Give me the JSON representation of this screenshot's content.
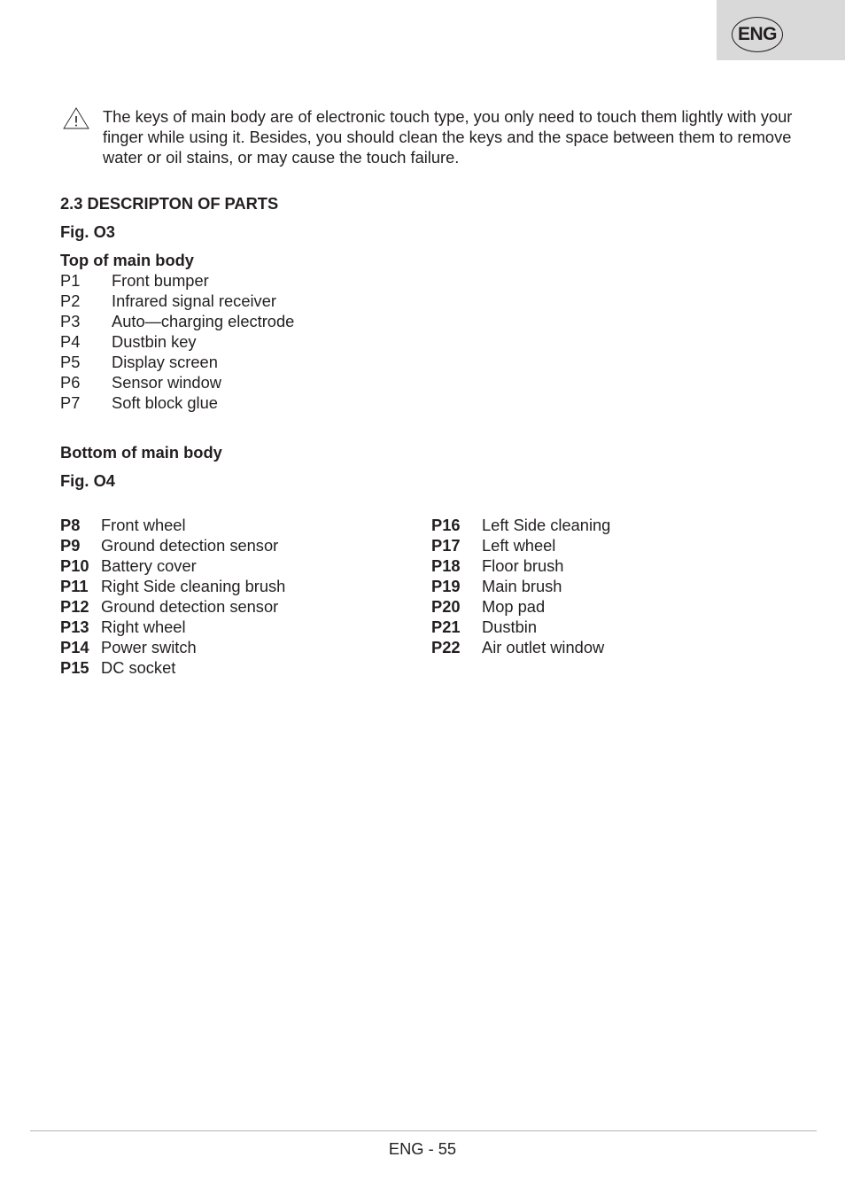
{
  "header": {
    "language_badge": "ENG"
  },
  "warning": {
    "icon": "warning-triangle-icon",
    "text": "The keys of main body are of electronic touch type, you only need to touch them lightly with your finger while using it. Besides, you should clean the keys and the space between them to remove water or oil stains, or may cause the touch failure."
  },
  "section": {
    "title": "2.3 DESCRIPTON OF PARTS",
    "top": {
      "figure": "Fig. O3",
      "heading": "Top of main body",
      "items": [
        {
          "code": "P1",
          "label": "Front bumper"
        },
        {
          "code": "P2",
          "label": "Infrared signal receiver"
        },
        {
          "code": "P3",
          "label": "Auto—charging electrode"
        },
        {
          "code": "P4",
          "label": "Dustbin key"
        },
        {
          "code": "P5",
          "label": "Display screen"
        },
        {
          "code": "P6",
          "label": "Sensor window"
        },
        {
          "code": "P7",
          "label": "Soft block glue"
        }
      ]
    },
    "bottom": {
      "heading": "Bottom of main body",
      "figure": "Fig. O4",
      "left_items": [
        {
          "code": "P8",
          "label": "Front wheel"
        },
        {
          "code": "P9",
          "label": "Ground detection sensor"
        },
        {
          "code": "P10",
          "label": "Battery cover"
        },
        {
          "code": "P11",
          "label": "Right Side cleaning brush"
        },
        {
          "code": "P12",
          "label": "Ground detection sensor"
        },
        {
          "code": "P13",
          "label": "Right wheel"
        },
        {
          "code": "P14",
          "label": "Power switch"
        },
        {
          "code": "P15",
          "label": "DC socket"
        }
      ],
      "right_items": [
        {
          "code": "P16",
          "label": "Left Side cleaning"
        },
        {
          "code": "P17",
          "label": "Left wheel"
        },
        {
          "code": "P18",
          "label": "Floor brush"
        },
        {
          "code": "P19",
          "label": "Main brush"
        },
        {
          "code": "P20",
          "label": "Mop pad"
        },
        {
          "code": "P21",
          "label": "Dustbin"
        },
        {
          "code": "P22",
          "label": "Air outlet window"
        }
      ]
    }
  },
  "footer": {
    "page_number": "ENG - 55"
  }
}
